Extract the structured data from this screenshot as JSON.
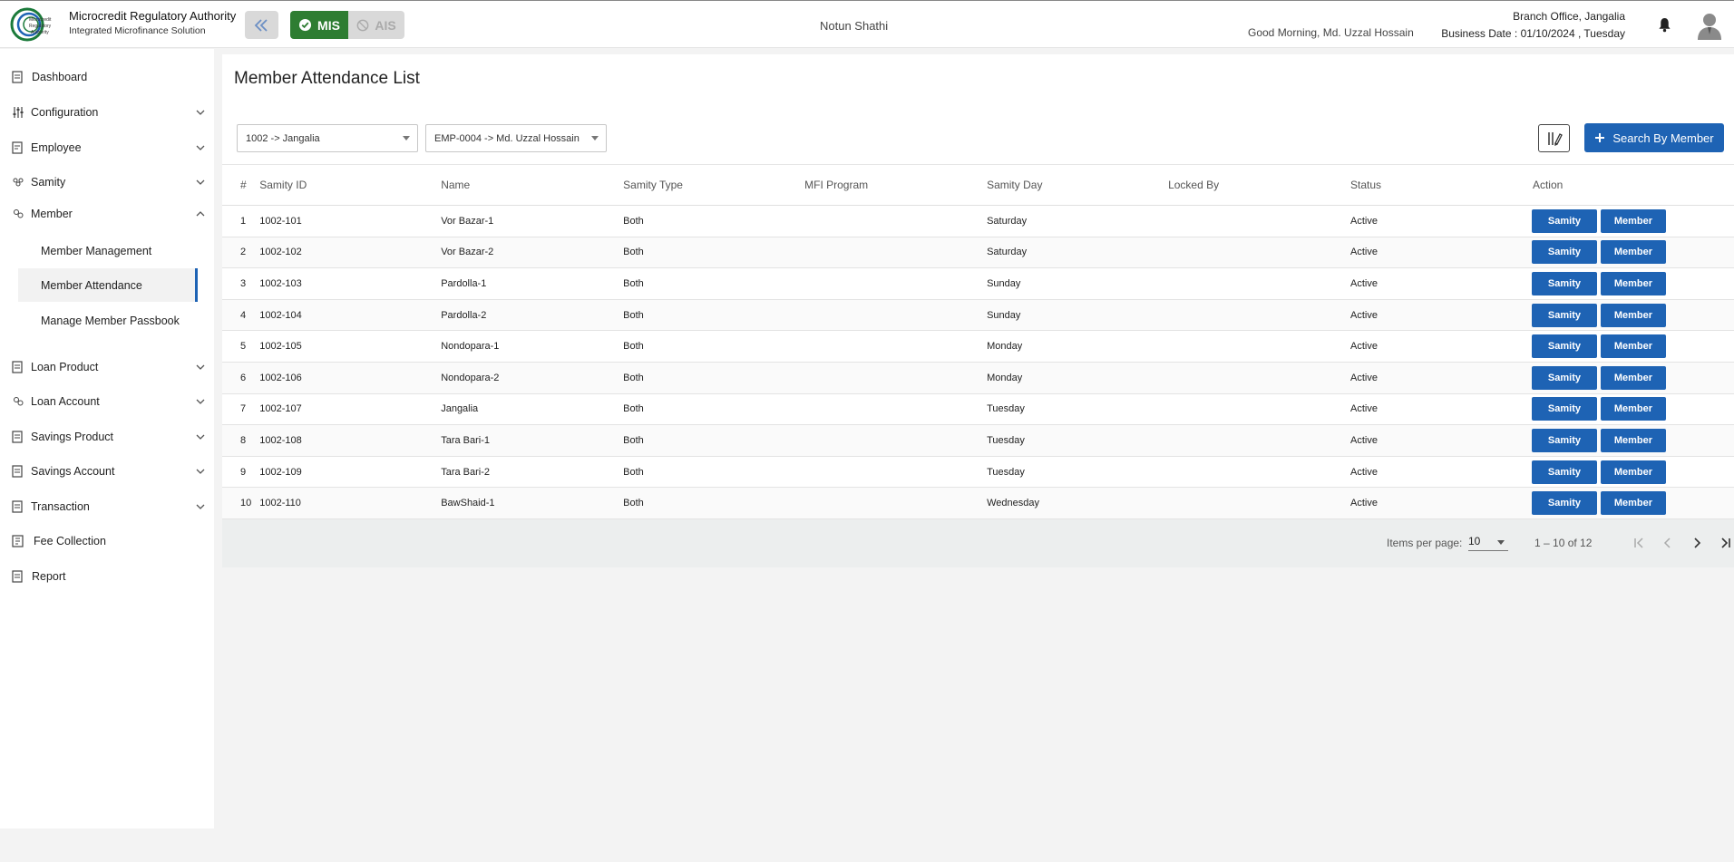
{
  "header": {
    "brand_title": "Microcredit Regulatory Authority",
    "brand_subtitle": "Integrated Microfinance Solution",
    "logo_text": "Microcredit Regulatory Authority",
    "mode_mis": "MIS",
    "mode_ais": "AIS",
    "org_name": "Notun Shathi",
    "greeting": "Good Morning, Md. Uzzal Hossain",
    "branch": "Branch Office, Jangalia",
    "business_date": "Business Date : 01/10/2024 , Tuesday"
  },
  "sidebar": {
    "items": [
      {
        "label": "Dashboard",
        "icon": "dashboard-icon"
      },
      {
        "label": "Configuration",
        "icon": "sliders-icon"
      },
      {
        "label": "Employee",
        "icon": "employee-icon"
      },
      {
        "label": "Samity",
        "icon": "group-icon"
      },
      {
        "label": "Member",
        "icon": "members-icon"
      },
      {
        "label": "Loan Product",
        "icon": "loan-product-icon"
      },
      {
        "label": "Loan Account",
        "icon": "loan-account-icon"
      },
      {
        "label": "Savings Product",
        "icon": "savings-product-icon"
      },
      {
        "label": "Savings Account",
        "icon": "savings-account-icon"
      },
      {
        "label": "Transaction",
        "icon": "transaction-icon"
      },
      {
        "label": "Fee Collection",
        "icon": "fee-icon"
      },
      {
        "label": "Report",
        "icon": "report-icon"
      }
    ],
    "member_sub": [
      {
        "label": "Member Management"
      },
      {
        "label": "Member Attendance"
      },
      {
        "label": "Manage Member Passbook"
      }
    ]
  },
  "page": {
    "title": "Member Attendance List",
    "branch_select": "1002 -> Jangalia",
    "employee_select": "EMP-0004 -> Md. Uzzal Hossain",
    "search_button": "Search By Member"
  },
  "table": {
    "headers": [
      "#",
      "Samity ID",
      "Name",
      "Samity Type",
      "MFI Program",
      "Samity Day",
      "Locked By",
      "Status",
      "Action"
    ],
    "rows": [
      {
        "n": "1",
        "id": "1002-101",
        "name": "Vor Bazar-1",
        "type": "Both",
        "mfi": "",
        "day": "Saturday",
        "locked": "",
        "status": "Active"
      },
      {
        "n": "2",
        "id": "1002-102",
        "name": "Vor Bazar-2",
        "type": "Both",
        "mfi": "",
        "day": "Saturday",
        "locked": "",
        "status": "Active"
      },
      {
        "n": "3",
        "id": "1002-103",
        "name": "Pardolla-1",
        "type": "Both",
        "mfi": "",
        "day": "Sunday",
        "locked": "",
        "status": "Active"
      },
      {
        "n": "4",
        "id": "1002-104",
        "name": "Pardolla-2",
        "type": "Both",
        "mfi": "",
        "day": "Sunday",
        "locked": "",
        "status": "Active"
      },
      {
        "n": "5",
        "id": "1002-105",
        "name": "Nondopara-1",
        "type": "Both",
        "mfi": "",
        "day": "Monday",
        "locked": "",
        "status": "Active"
      },
      {
        "n": "6",
        "id": "1002-106",
        "name": "Nondopara-2",
        "type": "Both",
        "mfi": "",
        "day": "Monday",
        "locked": "",
        "status": "Active"
      },
      {
        "n": "7",
        "id": "1002-107",
        "name": "Jangalia",
        "type": "Both",
        "mfi": "",
        "day": "Tuesday",
        "locked": "",
        "status": "Active"
      },
      {
        "n": "8",
        "id": "1002-108",
        "name": "Tara Bari-1",
        "type": "Both",
        "mfi": "",
        "day": "Tuesday",
        "locked": "",
        "status": "Active"
      },
      {
        "n": "9",
        "id": "1002-109",
        "name": "Tara Bari-2",
        "type": "Both",
        "mfi": "",
        "day": "Tuesday",
        "locked": "",
        "status": "Active"
      },
      {
        "n": "10",
        "id": "1002-110",
        "name": "BawShaid-1",
        "type": "Both",
        "mfi": "",
        "day": "Wednesday",
        "locked": "",
        "status": "Active"
      }
    ],
    "action_samity": "Samity",
    "action_member": "Member"
  },
  "paginator": {
    "items_per_page_label": "Items per page:",
    "items_per_page": "10",
    "range": "1 – 10 of 12"
  },
  "colors": {
    "primary": "#1e63b4",
    "mis_green": "#2e7d32"
  }
}
